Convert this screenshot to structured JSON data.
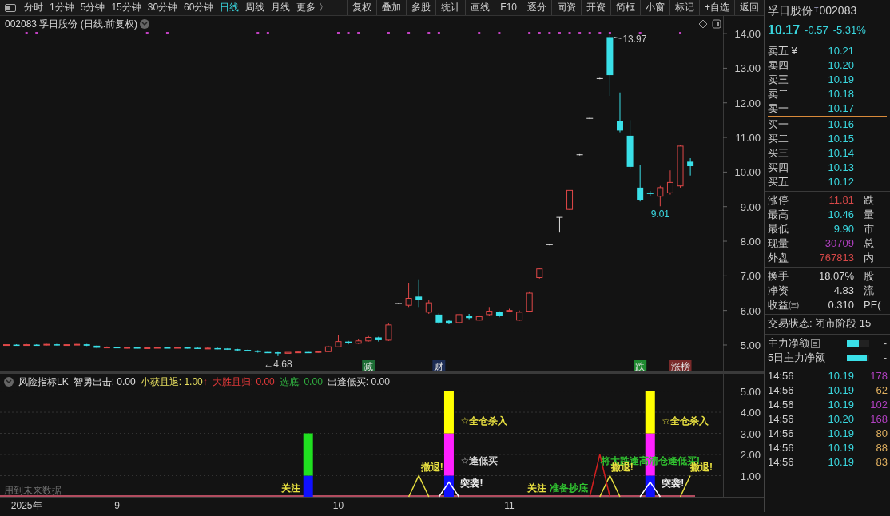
{
  "toolbar": {
    "periods": [
      {
        "label": "分时",
        "selected": false
      },
      {
        "label": "1分钟",
        "selected": false
      },
      {
        "label": "5分钟",
        "selected": false
      },
      {
        "label": "15分钟",
        "selected": false
      },
      {
        "label": "30分钟",
        "selected": false
      },
      {
        "label": "60分钟",
        "selected": false
      },
      {
        "label": "日线",
        "selected": true
      },
      {
        "label": "周线",
        "selected": false
      },
      {
        "label": "月线",
        "selected": false
      }
    ],
    "more": {
      "label": "更多",
      "arrow": "〉"
    },
    "buttons": [
      "复权",
      "叠加",
      "多股",
      "统计",
      "画线",
      "F10",
      "逐分",
      "同资",
      "开资",
      "简框",
      "小窗",
      "标记",
      "+自选",
      "返回"
    ]
  },
  "main_chart": {
    "title": "002083 孚日股份 (日线.前复权)",
    "signal_row": [
      false,
      false,
      true,
      true,
      false,
      false,
      false,
      false,
      false,
      false,
      false,
      false,
      false,
      false,
      true,
      false,
      true,
      false,
      false,
      false,
      false,
      false,
      false,
      false,
      false,
      true,
      true,
      false,
      false,
      false,
      false,
      false,
      false,
      true,
      true,
      true,
      false,
      false,
      true,
      false,
      true,
      false,
      true,
      true,
      false,
      false,
      false,
      true,
      false,
      true,
      false,
      false,
      true,
      true,
      true,
      true,
      true,
      true,
      true,
      true,
      true,
      false,
      false,
      true,
      false,
      false,
      false,
      true,
      false
    ],
    "event_tags": [
      {
        "color": "#1d6e35"
      },
      {
        "color": "#1c2c54"
      },
      {
        "color": "#1f8a30"
      },
      {
        "color": "#7a2a2a"
      }
    ],
    "chart_data": {
      "type": "candlestick",
      "ylim": [
        4.215,
        14.51
      ],
      "yticks": [
        {
          "value": 5,
          "label": "5.00"
        },
        {
          "value": 6,
          "label": "6.00"
        },
        {
          "value": 7,
          "label": "7.00"
        },
        {
          "value": 8,
          "label": "8.00"
        },
        {
          "value": 9,
          "label": "9.00"
        },
        {
          "value": 10,
          "label": "10.00"
        },
        {
          "value": 11,
          "label": "11.00"
        },
        {
          "value": 12,
          "label": "12.00"
        },
        {
          "value": 13,
          "label": "13.00"
        },
        {
          "value": 14,
          "label": "14.00"
        }
      ],
      "categories": [
        null,
        null,
        null,
        null,
        null,
        null,
        null,
        null,
        null,
        null,
        null,
        null,
        null,
        null,
        null,
        null,
        null,
        null,
        null,
        null,
        null,
        null,
        null,
        null,
        null,
        null,
        null,
        null,
        null,
        null,
        null,
        null,
        null,
        null,
        null,
        null,
        "减",
        null,
        null,
        null,
        null,
        null,
        null,
        "财",
        null,
        null,
        null,
        null,
        null,
        null,
        null,
        null,
        null,
        null,
        null,
        null,
        null,
        null,
        null,
        null,
        null,
        null,
        null,
        "跌",
        null,
        null,
        null,
        "涨榜",
        null
      ],
      "ohlc": [
        [
          5.0,
          5.02,
          4.99,
          5.01
        ],
        [
          5.01,
          5.02,
          4.98,
          4.99
        ],
        [
          4.99,
          5.03,
          4.98,
          5.01
        ],
        [
          5.01,
          5.02,
          4.99,
          5.0
        ],
        [
          5.0,
          5.03,
          4.99,
          5.02
        ],
        [
          5.02,
          5.03,
          4.99,
          5.0
        ],
        [
          5.0,
          5.02,
          4.99,
          5.01
        ],
        [
          5.01,
          5.03,
          5.0,
          5.02
        ],
        [
          5.02,
          5.03,
          4.97,
          4.98
        ],
        [
          4.98,
          4.99,
          4.9,
          4.92
        ],
        [
          4.92,
          4.96,
          4.91,
          4.94
        ],
        [
          4.94,
          4.95,
          4.91,
          4.92
        ],
        [
          4.92,
          4.95,
          4.9,
          4.93
        ],
        [
          4.93,
          4.94,
          4.89,
          4.9
        ],
        [
          4.9,
          4.94,
          4.89,
          4.92
        ],
        [
          4.92,
          4.95,
          4.91,
          4.93
        ],
        [
          4.93,
          4.95,
          4.91,
          4.92
        ],
        [
          4.92,
          4.94,
          4.91,
          4.93
        ],
        [
          4.93,
          4.94,
          4.9,
          4.92
        ],
        [
          4.92,
          4.93,
          4.89,
          4.9
        ],
        [
          4.9,
          4.93,
          4.89,
          4.91
        ],
        [
          4.91,
          4.92,
          4.88,
          4.9
        ],
        [
          4.9,
          4.91,
          4.86,
          4.88
        ],
        [
          4.88,
          4.89,
          4.84,
          4.86
        ],
        [
          4.86,
          4.87,
          4.82,
          4.84
        ],
        [
          4.84,
          4.85,
          4.78,
          4.8
        ],
        [
          4.8,
          4.82,
          4.77,
          4.79
        ],
        [
          4.79,
          4.8,
          4.68,
          4.76
        ],
        [
          4.76,
          4.82,
          4.74,
          4.79
        ],
        [
          4.79,
          4.82,
          4.77,
          4.8
        ],
        [
          4.8,
          4.82,
          4.77,
          4.79
        ],
        [
          4.79,
          4.83,
          4.78,
          4.81
        ],
        [
          4.81,
          4.98,
          4.8,
          4.95
        ],
        [
          4.95,
          5.28,
          4.93,
          5.1
        ],
        [
          5.1,
          5.12,
          5.02,
          5.05
        ],
        [
          5.05,
          5.18,
          5.03,
          5.12
        ],
        [
          5.12,
          5.26,
          5.1,
          5.22
        ],
        [
          5.22,
          5.24,
          5.1,
          5.14
        ],
        [
          5.14,
          5.62,
          5.12,
          5.58
        ],
        [
          6.2,
          6.22,
          6.18,
          6.2
        ],
        [
          6.15,
          6.8,
          6.1,
          6.35
        ],
        [
          6.4,
          6.9,
          6.1,
          6.3
        ],
        [
          5.95,
          6.3,
          5.9,
          6.22
        ],
        [
          5.88,
          5.92,
          5.6,
          5.65
        ],
        [
          5.7,
          5.72,
          5.6,
          5.62
        ],
        [
          5.65,
          5.92,
          5.6,
          5.88
        ],
        [
          5.85,
          5.9,
          5.75,
          5.78
        ],
        [
          5.72,
          5.86,
          5.7,
          5.82
        ],
        [
          5.88,
          6.1,
          5.85,
          5.98
        ],
        [
          5.95,
          5.98,
          5.8,
          5.85
        ],
        [
          5.98,
          6.05,
          5.95,
          6.0
        ],
        [
          5.72,
          6.0,
          5.7,
          5.95
        ],
        [
          5.98,
          6.55,
          5.95,
          6.5
        ],
        [
          6.95,
          7.22,
          6.92,
          7.2
        ],
        [
          7.9,
          7.92,
          7.88,
          7.9
        ],
        [
          8.69,
          8.69,
          8.25,
          8.69
        ],
        [
          8.92,
          9.47,
          8.9,
          9.47
        ],
        [
          10.5,
          10.52,
          10.48,
          10.5
        ],
        [
          11.55,
          11.57,
          11.53,
          11.55
        ],
        [
          12.7,
          12.72,
          12.68,
          12.7
        ],
        [
          13.9,
          13.97,
          12.2,
          12.8
        ],
        [
          11.47,
          12.3,
          11.15,
          11.2
        ],
        [
          11.05,
          11.5,
          10.1,
          10.15
        ],
        [
          9.55,
          10.2,
          9.15,
          9.18
        ],
        [
          9.4,
          9.45,
          9.3,
          9.37
        ],
        [
          9.3,
          9.6,
          9.01,
          9.55
        ],
        [
          9.4,
          10.05,
          9.35,
          9.7
        ],
        [
          9.6,
          10.78,
          9.55,
          10.75
        ],
        [
          10.3,
          10.4,
          9.9,
          10.17
        ]
      ],
      "annotations": [
        "13.97",
        "9.01",
        "←4.68"
      ]
    }
  },
  "indicator": {
    "name": "风险指标LK",
    "legend": [
      {
        "text": "智勇出击: 0.00",
        "color": "#e8e8e8"
      },
      {
        "text": "小获且退: 1.00",
        "color": "#e8e060",
        "arrow": "↑"
      },
      {
        "text": "大胜且归: 0.00",
        "color": "#e83a3a"
      },
      {
        "text": "选底: 0.00",
        "color": "#30b040"
      },
      {
        "text": "出逢低买: 0.00",
        "color": "#d8d8d8"
      }
    ],
    "note": "用到未来数据",
    "signal_labels": [
      {
        "color": "#e8e040"
      },
      {
        "color": "#e8e040"
      },
      {
        "color": "#e8e040"
      },
      {
        "color": "#d8d8d8"
      },
      {
        "color": "#f0f0f0"
      },
      {
        "color": "#e8e040"
      },
      {
        "color": "#30c030"
      },
      {
        "color": "#e8e040"
      },
      {
        "color": "#e8e040"
      },
      {
        "color": "#f0f0f0"
      },
      {
        "color": "#30c030"
      },
      {
        "color": "#e8e040"
      }
    ],
    "chart_data": {
      "type": "bar",
      "stacked": true,
      "grid": true,
      "ylim": [
        0,
        5.85
      ],
      "categories": [
        null,
        null,
        "2025年",
        null,
        null,
        null,
        null,
        null,
        null,
        null,
        null,
        "9",
        null,
        null,
        null,
        null,
        null,
        null,
        null,
        null,
        null,
        null,
        null,
        null,
        null,
        null,
        null,
        null,
        null,
        null,
        null,
        null,
        null,
        "10",
        null,
        null,
        null,
        null,
        null,
        null,
        null,
        null,
        null,
        null,
        null,
        null,
        null,
        null,
        null,
        null,
        "11",
        null,
        null,
        null,
        null,
        null,
        null,
        null,
        null,
        null,
        null,
        null,
        null,
        null,
        null,
        null,
        null,
        null,
        null
      ],
      "yticks": [
        {
          "value": 1,
          "label": "1.00"
        },
        {
          "value": 2,
          "label": "2.00"
        },
        {
          "value": 3,
          "label": "3.00"
        },
        {
          "value": 4,
          "label": "4.00"
        },
        {
          "value": 5,
          "label": "5.00"
        }
      ],
      "series": [
        {
          "type": "bar",
          "color": "#1010ff",
          "values": [
            null,
            null,
            null,
            null,
            null,
            null,
            null,
            null,
            null,
            null,
            null,
            null,
            null,
            null,
            null,
            null,
            null,
            null,
            null,
            null,
            null,
            null,
            null,
            null,
            null,
            null,
            null,
            null,
            null,
            null,
            1,
            null,
            null,
            null,
            null,
            null,
            null,
            null,
            null,
            null,
            null,
            null,
            null,
            null,
            1,
            null,
            null,
            null,
            null,
            null,
            null,
            null,
            null,
            null,
            null,
            null,
            null,
            null,
            null,
            null,
            null,
            null,
            null,
            null,
            1,
            null,
            null,
            null,
            null
          ]
        },
        {
          "type": "bar",
          "color": "#20e020",
          "values": [
            null,
            null,
            null,
            null,
            null,
            null,
            null,
            null,
            null,
            null,
            null,
            null,
            null,
            null,
            null,
            null,
            null,
            null,
            null,
            null,
            null,
            null,
            null,
            null,
            null,
            null,
            null,
            null,
            null,
            null,
            2,
            null,
            null,
            null,
            null,
            null,
            null,
            null,
            null,
            null,
            null,
            null,
            null,
            null,
            null,
            null,
            null,
            null,
            null,
            null,
            null,
            null,
            null,
            null,
            null,
            null,
            null,
            null,
            null,
            null,
            null,
            null,
            null,
            null,
            null,
            null,
            null,
            null,
            null
          ]
        },
        {
          "type": "bar",
          "color": "#ff20ff",
          "values": [
            null,
            null,
            null,
            null,
            null,
            null,
            null,
            null,
            null,
            null,
            null,
            null,
            null,
            null,
            null,
            null,
            null,
            null,
            null,
            null,
            null,
            null,
            null,
            null,
            null,
            null,
            null,
            null,
            null,
            null,
            null,
            null,
            null,
            null,
            null,
            null,
            null,
            null,
            null,
            null,
            null,
            null,
            null,
            null,
            2,
            null,
            null,
            null,
            null,
            null,
            null,
            null,
            null,
            null,
            null,
            null,
            null,
            null,
            null,
            null,
            null,
            null,
            null,
            null,
            2,
            null,
            null,
            null,
            null
          ]
        },
        {
          "type": "bar",
          "color": "#ffff00",
          "values": [
            null,
            null,
            null,
            null,
            null,
            null,
            null,
            null,
            null,
            null,
            null,
            null,
            null,
            null,
            null,
            null,
            null,
            null,
            null,
            null,
            null,
            null,
            null,
            null,
            null,
            null,
            null,
            null,
            null,
            null,
            null,
            null,
            null,
            null,
            null,
            null,
            null,
            null,
            null,
            null,
            null,
            null,
            null,
            null,
            2,
            null,
            null,
            null,
            null,
            null,
            null,
            null,
            null,
            null,
            null,
            null,
            null,
            null,
            null,
            null,
            null,
            null,
            null,
            null,
            2,
            null,
            null,
            null,
            null
          ]
        },
        {
          "type": "line",
          "color": "#e8e040",
          "values": [
            null,
            null,
            null,
            null,
            null,
            null,
            null,
            null,
            null,
            null,
            null,
            null,
            null,
            null,
            null,
            null,
            null,
            null,
            null,
            null,
            null,
            null,
            null,
            null,
            null,
            null,
            null,
            null,
            null,
            null,
            null,
            null,
            null,
            null,
            null,
            null,
            null,
            null,
            null,
            null,
            0,
            1,
            0,
            null,
            null,
            null,
            null,
            null,
            null,
            null,
            null,
            null,
            null,
            null,
            null,
            null,
            null,
            null,
            null,
            0,
            1,
            0,
            null,
            null,
            null,
            null,
            null,
            0,
            1
          ]
        },
        {
          "type": "line",
          "color": "#ffffff",
          "values": [
            null,
            null,
            null,
            null,
            null,
            null,
            null,
            null,
            null,
            null,
            null,
            null,
            null,
            null,
            null,
            null,
            null,
            null,
            null,
            null,
            null,
            null,
            null,
            null,
            null,
            null,
            null,
            null,
            null,
            null,
            null,
            null,
            null,
            null,
            null,
            null,
            null,
            null,
            null,
            null,
            null,
            null,
            null,
            0,
            0.7,
            0,
            null,
            null,
            null,
            null,
            null,
            null,
            null,
            null,
            null,
            null,
            null,
            null,
            null,
            null,
            null,
            null,
            null,
            0,
            0.7,
            0,
            null,
            null,
            null
          ]
        },
        {
          "type": "line",
          "color": "#d02020",
          "values": [
            null,
            null,
            null,
            null,
            null,
            null,
            null,
            null,
            null,
            null,
            null,
            null,
            null,
            null,
            null,
            null,
            null,
            null,
            null,
            null,
            null,
            null,
            null,
            null,
            null,
            null,
            null,
            null,
            null,
            null,
            null,
            null,
            null,
            null,
            null,
            null,
            null,
            null,
            null,
            null,
            null,
            null,
            null,
            null,
            null,
            null,
            null,
            null,
            null,
            null,
            null,
            null,
            null,
            null,
            null,
            null,
            null,
            null,
            0,
            2,
            0,
            null,
            null,
            null,
            null,
            null,
            null,
            null,
            null
          ]
        }
      ],
      "annotations": [
        "关注",
        "撤退!",
        "☆全仓杀入",
        "☆逢低买",
        "突袭!",
        "关注",
        "将大跌逢高清仓逢低买!",
        "撤退!",
        "☆全仓杀入",
        "突袭!",
        "准备抄底",
        "撤退!"
      ]
    }
  },
  "quote": {
    "name": "孚日股份",
    "badge": "T",
    "code": "002083",
    "price": "10.17",
    "change": "-0.57",
    "change_pct": "-5.31%"
  },
  "order_book": {
    "asks": [
      {
        "label": "卖五",
        "mark": "¥",
        "price": "10.21"
      },
      {
        "label": "卖四",
        "price": "10.20"
      },
      {
        "label": "卖三",
        "price": "10.19"
      },
      {
        "label": "卖二",
        "price": "10.18"
      },
      {
        "label": "卖一",
        "price": "10.17"
      }
    ],
    "bids": [
      {
        "label": "买一",
        "price": "10.16"
      },
      {
        "label": "买二",
        "price": "10.15"
      },
      {
        "label": "买三",
        "price": "10.14"
      },
      {
        "label": "买四",
        "price": "10.13"
      },
      {
        "label": "买五",
        "price": "10.12"
      }
    ]
  },
  "stats_groups": [
    [
      {
        "label": "涨停",
        "value": "11.81",
        "color": "#d84848",
        "side": "跌"
      },
      {
        "label": "最高",
        "value": "10.46",
        "color": "#3ad8e0",
        "side": "量"
      },
      {
        "label": "最低",
        "value": "9.90",
        "color": "#3ad8e0",
        "side": "市"
      },
      {
        "label": "现量",
        "value": "30709",
        "color": "#b040c0",
        "side": "总"
      },
      {
        "label": "外盘",
        "value": "767813",
        "color": "#d84848",
        "side": "内"
      }
    ],
    [
      {
        "label": "换手",
        "value": "18.07%",
        "color": "#d8d8d8",
        "side": "股"
      },
      {
        "label": "净资",
        "value": "4.83",
        "color": "#d8d8d8",
        "side": "流"
      },
      {
        "label": "收益㈢",
        "value": "0.310",
        "color": "#d8d8d8",
        "side": "PE("
      }
    ]
  ],
  "trade_status": "交易状态: 闭市阶段 15",
  "fund_flow": [
    {
      "label": "主力净额",
      "value": "-",
      "level": 0.55,
      "note_icon": true
    },
    {
      "label": "5日主力净额",
      "value": "-",
      "level": 0.9,
      "note_icon": false
    }
  ],
  "ticks": [
    {
      "time": "14:56",
      "price": "10.19",
      "volume": "178",
      "color": "#b040c0"
    },
    {
      "time": "14:56",
      "price": "10.19",
      "volume": "62",
      "color": "#e0b060"
    },
    {
      "time": "14:56",
      "price": "10.19",
      "volume": "102",
      "color": "#b040c0"
    },
    {
      "time": "14:56",
      "price": "10.20",
      "volume": "168",
      "color": "#b040c0"
    },
    {
      "time": "14:56",
      "price": "10.19",
      "volume": "80",
      "color": "#e0b060"
    },
    {
      "time": "14:56",
      "price": "10.19",
      "volume": "88",
      "color": "#e0b060"
    },
    {
      "time": "14:56",
      "price": "10.19",
      "volume": "83",
      "color": "#e0b060"
    }
  ]
}
